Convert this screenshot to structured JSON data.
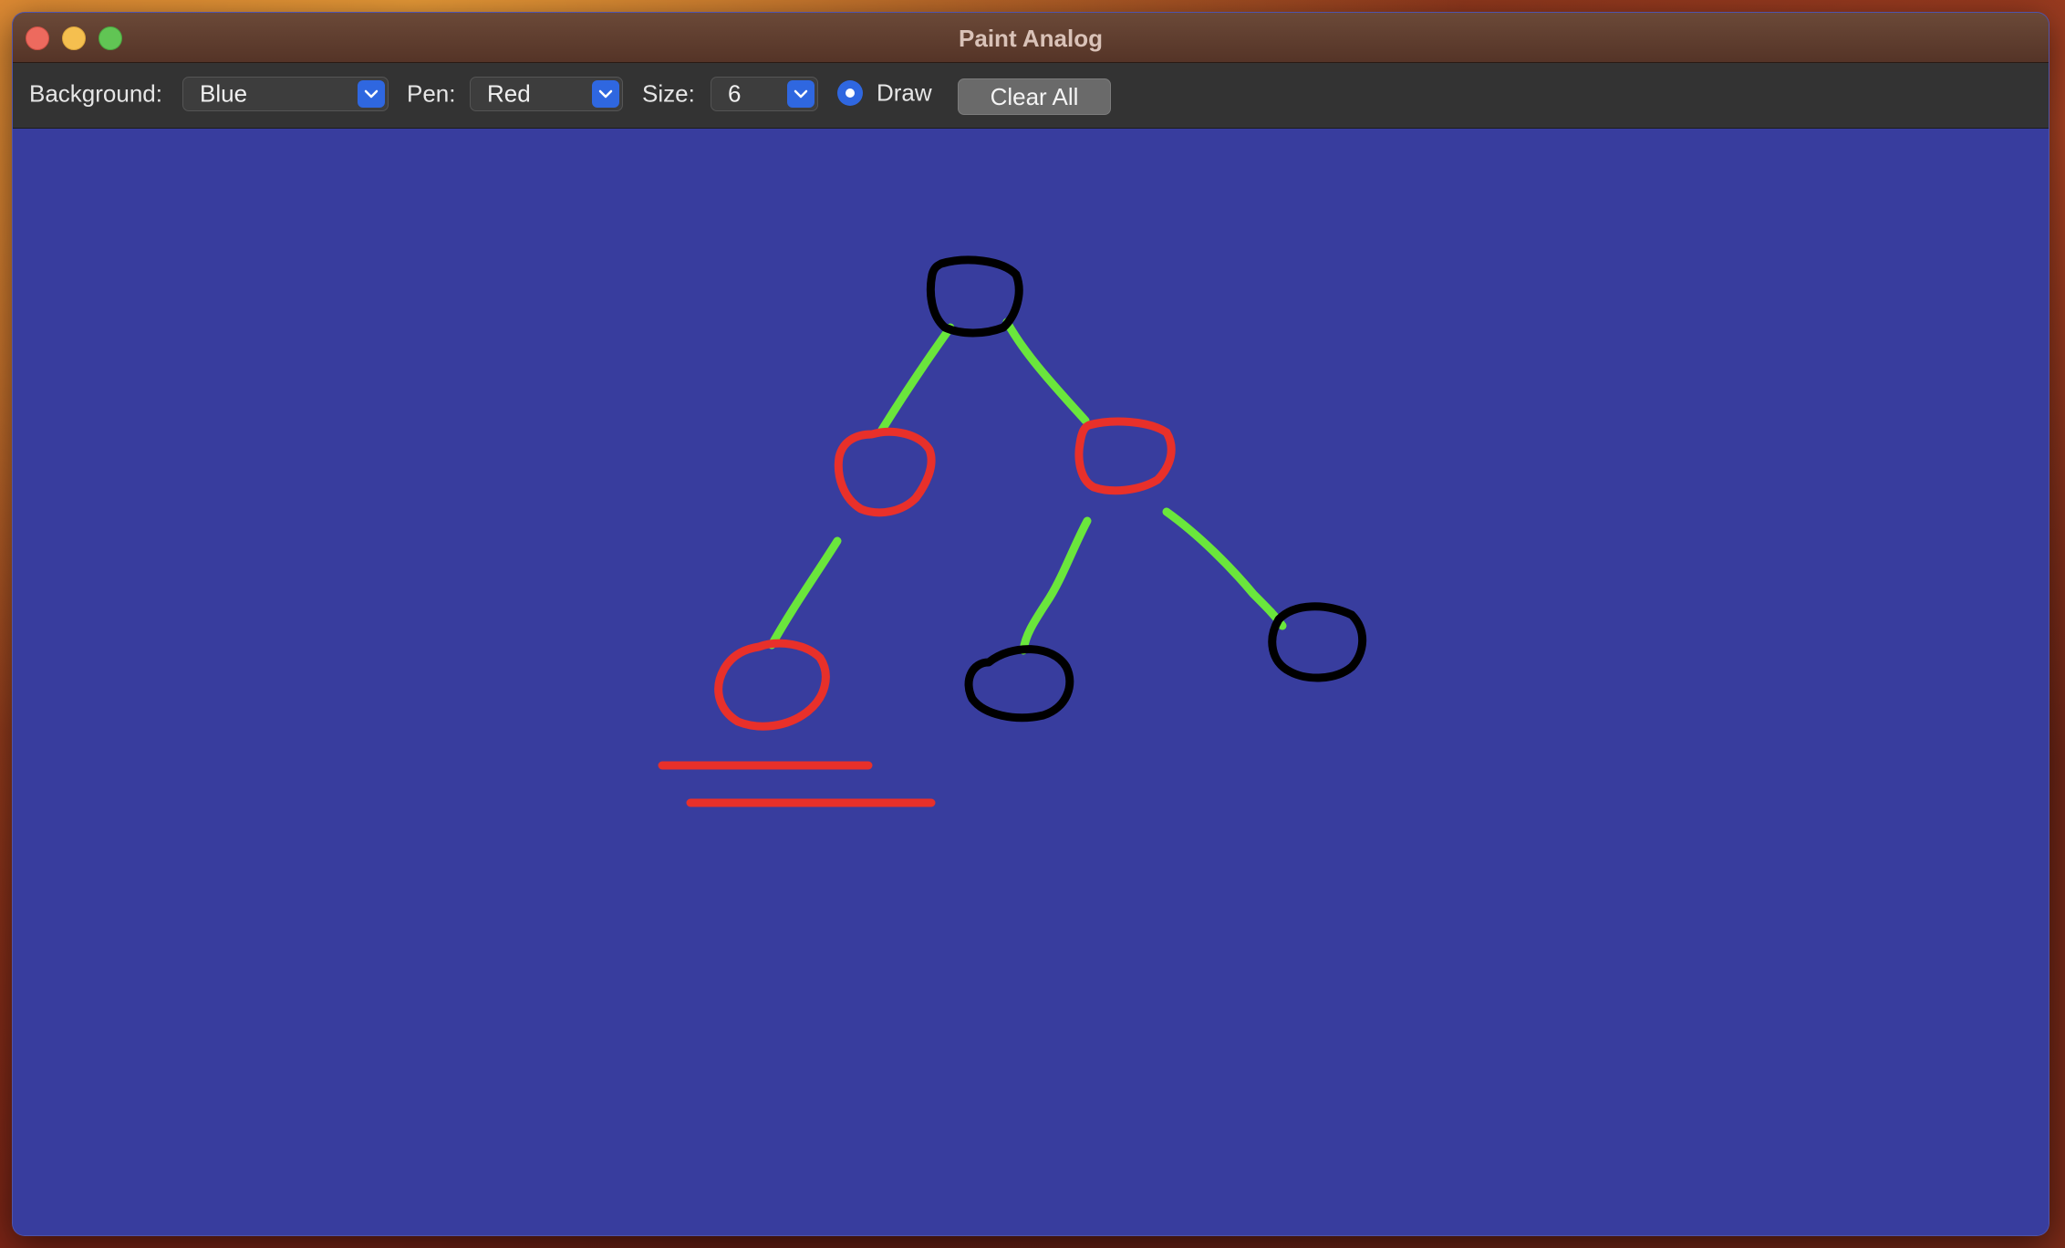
{
  "window": {
    "title": "Paint Analog"
  },
  "toolbar": {
    "background_label": "Background:",
    "background_value": "Blue",
    "pen_label": "Pen:",
    "pen_value": "Red",
    "size_label": "Size:",
    "size_value": "6",
    "draw_label": "Draw",
    "draw_selected": true,
    "clear_label": "Clear All"
  },
  "colors": {
    "canvas_background": "#383d9e",
    "stroke_black": "#000000",
    "stroke_red": "#e8302a",
    "stroke_green": "#6ae63c",
    "accent": "#2f67e0"
  },
  "icons": {
    "dropdown": "chevron-down-icon",
    "close": "close-icon",
    "minimize": "minimize-icon",
    "maximize": "maximize-icon"
  }
}
